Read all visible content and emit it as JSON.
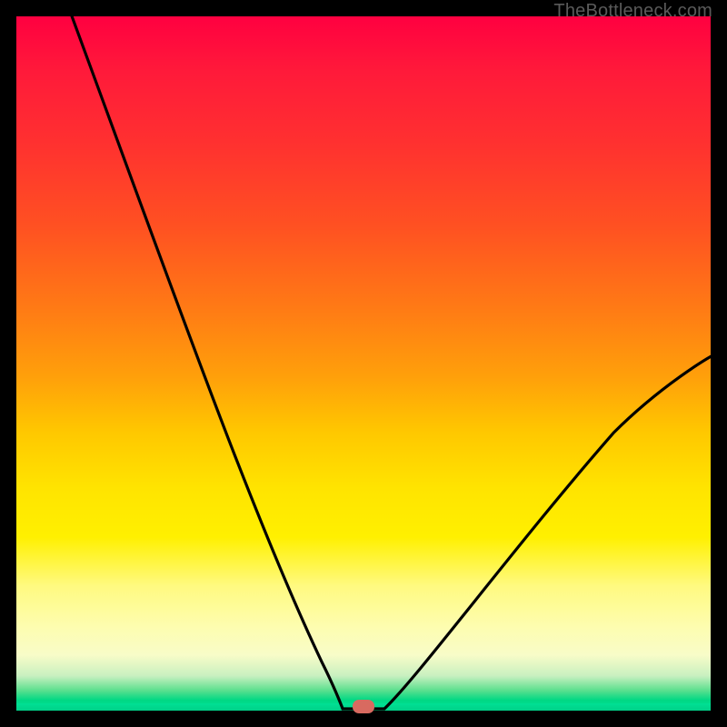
{
  "watermark": "TheBottleneck.com",
  "chart_data": {
    "type": "line",
    "title": "",
    "xlabel": "",
    "ylabel": "",
    "xlim": [
      0,
      100
    ],
    "ylim": [
      0,
      100
    ],
    "background_gradient": {
      "orientation": "vertical",
      "stops": [
        {
          "pos": 0,
          "color": "#ff0040"
        },
        {
          "pos": 50,
          "color": "#ffa000"
        },
        {
          "pos": 80,
          "color": "#fff000"
        },
        {
          "pos": 95,
          "color": "#d0f0c0"
        },
        {
          "pos": 100,
          "color": "#00d888"
        }
      ]
    },
    "series": [
      {
        "name": "bottleneck-curve",
        "color": "#000000",
        "comment": "V-shaped curve; y read as percent from top (0) to bottom (100). Minimum (touching bottom) near x≈50.",
        "x": [
          8,
          12,
          16,
          20,
          24,
          28,
          32,
          36,
          40,
          44,
          47,
          49,
          50,
          53,
          56,
          60,
          64,
          68,
          72,
          76,
          80,
          84,
          88,
          92,
          96,
          100
        ],
        "y": [
          0,
          15,
          28,
          40,
          51,
          61,
          69,
          77,
          84,
          90,
          95,
          99,
          100,
          100,
          97,
          93,
          88,
          83,
          78,
          73,
          68,
          63,
          58,
          54,
          51,
          49
        ]
      }
    ],
    "marker": {
      "name": "optimal-point",
      "shape": "rounded-rect",
      "x": 50,
      "y": 100,
      "color": "#d86a60"
    },
    "frame": {
      "color": "#000000",
      "thickness_px": 18
    }
  }
}
